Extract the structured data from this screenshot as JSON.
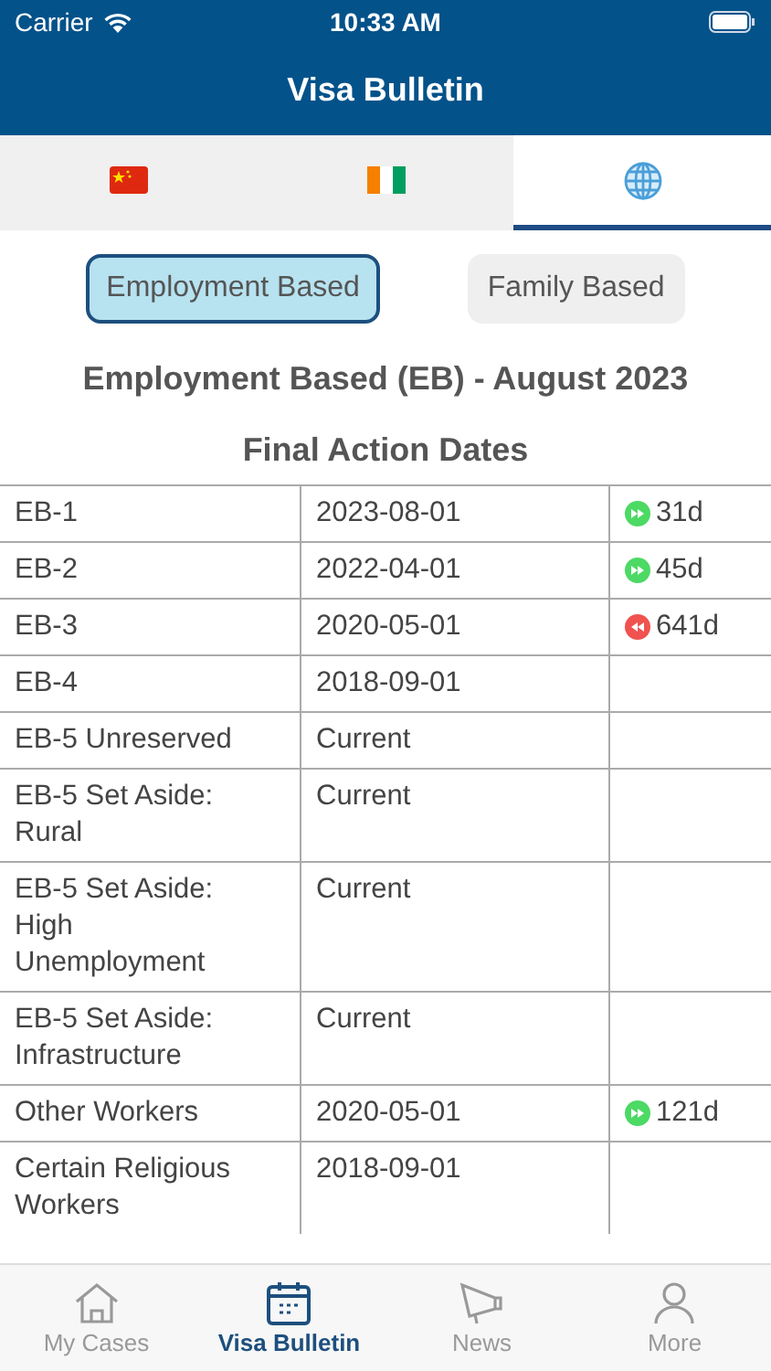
{
  "status_bar": {
    "carrier": "Carrier",
    "time": "10:33 AM"
  },
  "nav": {
    "title": "Visa Bulletin"
  },
  "country_tabs": [
    {
      "kind": "china",
      "selected": false
    },
    {
      "kind": "ivory",
      "selected": false
    },
    {
      "kind": "globe",
      "selected": true
    }
  ],
  "category_buttons": [
    {
      "label": "Employment Based",
      "selected": true
    },
    {
      "label": "Family Based",
      "selected": false
    }
  ],
  "heading": "Employment Based (EB) - August 2023",
  "subheading": "Final Action Dates",
  "table": {
    "rows": [
      {
        "category": "EB-1",
        "date": "2023-08-01",
        "change": {
          "kind": "advance",
          "text": "31d"
        }
      },
      {
        "category": "EB-2",
        "date": "2022-04-01",
        "change": {
          "kind": "advance",
          "text": "45d"
        }
      },
      {
        "category": "EB-3",
        "date": "2020-05-01",
        "change": {
          "kind": "retrogress",
          "text": "641d"
        }
      },
      {
        "category": "EB-4",
        "date": "2018-09-01"
      },
      {
        "category": "EB-5 Unreserved",
        "date": "Current"
      },
      {
        "category": "EB-5 Set Aside: Rural",
        "date": "Current"
      },
      {
        "category": "EB-5 Set Aside: High Unemployment",
        "date": "Current"
      },
      {
        "category": "EB-5 Set Aside: Infrastructure",
        "date": "Current"
      },
      {
        "category": "Other Workers",
        "date": "2020-05-01",
        "change": {
          "kind": "advance",
          "text": "121d"
        }
      },
      {
        "category": "Certain Religious Workers",
        "date": "2018-09-01"
      }
    ]
  },
  "tab_bar": [
    {
      "kind": "home",
      "label": "My Cases",
      "selected": false
    },
    {
      "kind": "calendar",
      "label": "Visa Bulletin",
      "selected": true
    },
    {
      "kind": "megaphone",
      "label": "News",
      "selected": false
    },
    {
      "kind": "person",
      "label": "More",
      "selected": false
    }
  ]
}
